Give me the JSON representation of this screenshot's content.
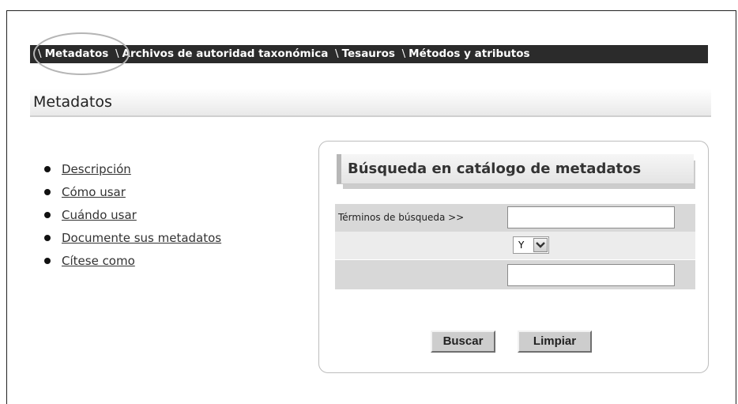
{
  "tabs": [
    {
      "label": "Metadatos"
    },
    {
      "label": "Archivos de autoridad taxonómica"
    },
    {
      "label": "Tesauros"
    },
    {
      "label": "Métodos y atributos"
    }
  ],
  "tab_separator": "\\",
  "page_title": "Metadatos",
  "menu": {
    "items": [
      {
        "label": "Descripción"
      },
      {
        "label": "Cómo usar"
      },
      {
        "label": "Cuándo usar"
      },
      {
        "label": "Documente sus metadatos"
      },
      {
        "label": "Cítese como"
      }
    ]
  },
  "search": {
    "title": "Búsqueda en catálogo de metadatos",
    "terms_label": "Términos de búsqueda >>",
    "terms_value": "",
    "operator_value": "Y",
    "second_value": "",
    "search_button": "Buscar",
    "clear_button": "Limpiar"
  }
}
